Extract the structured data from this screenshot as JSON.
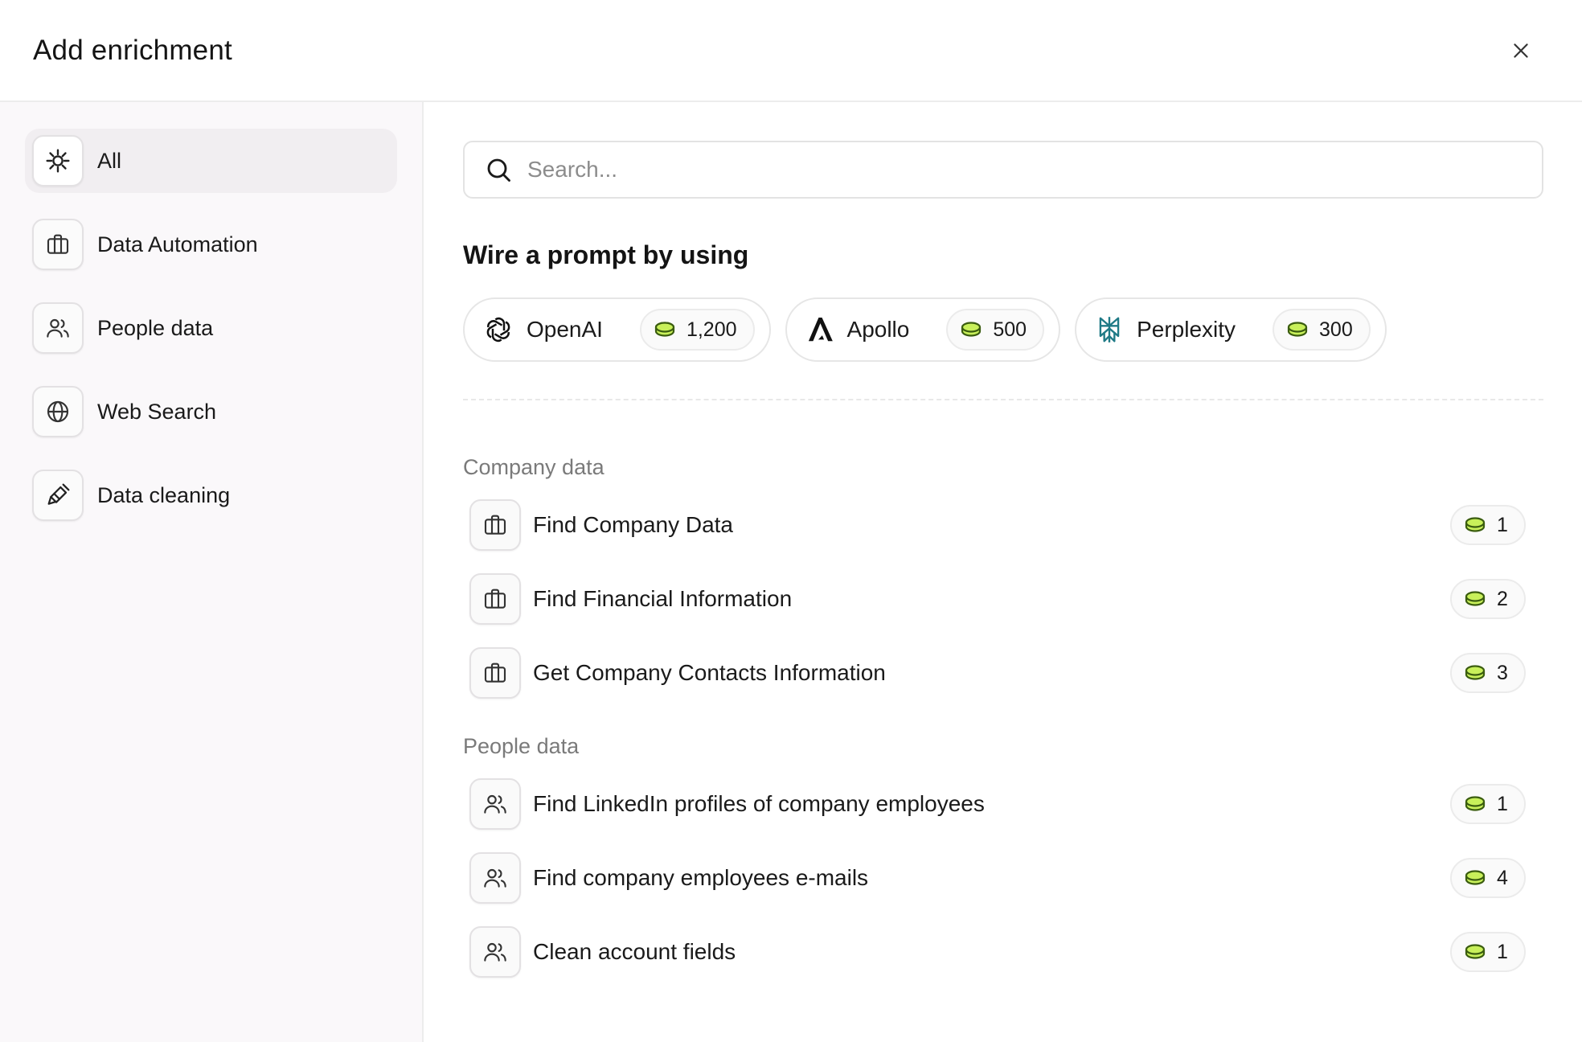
{
  "header": {
    "title": "Add enrichment"
  },
  "sidebar": {
    "items": [
      {
        "label": "All",
        "icon": "sparkle-icon",
        "active": true
      },
      {
        "label": "Data Automation",
        "icon": "briefcase-icon"
      },
      {
        "label": "People data",
        "icon": "users-icon"
      },
      {
        "label": "Web Search",
        "icon": "globe-icon"
      },
      {
        "label": "Data cleaning",
        "icon": "brush-icon"
      }
    ]
  },
  "search": {
    "placeholder": "Search..."
  },
  "prompt": {
    "heading": "Wire a prompt by using",
    "providers": [
      {
        "name": "OpenAI",
        "credits": "1,200",
        "icon": "openai-logo-icon"
      },
      {
        "name": "Apollo",
        "credits": "500",
        "icon": "apollo-logo-icon"
      },
      {
        "name": "Perplexity",
        "credits": "300",
        "icon": "perplexity-logo-icon"
      }
    ]
  },
  "groups": [
    {
      "label": "Company data",
      "items": [
        {
          "label": "Find Company Data",
          "credits": "1",
          "icon": "briefcase-icon"
        },
        {
          "label": "Find Financial Information",
          "credits": "2",
          "icon": "briefcase-icon"
        },
        {
          "label": "Get Company Contacts Information",
          "credits": "3",
          "icon": "briefcase-icon"
        }
      ]
    },
    {
      "label": "People data",
      "items": [
        {
          "label": "Find LinkedIn profiles of company employees",
          "credits": "1",
          "icon": "users-icon"
        },
        {
          "label": "Find company employees e-mails",
          "credits": "4",
          "icon": "users-icon"
        },
        {
          "label": "Clean account fields",
          "credits": "1",
          "icon": "users-icon"
        }
      ]
    }
  ],
  "colors": {
    "coin_fill": "#c8f05a",
    "coin_stroke": "#3b5d10",
    "perplexity": "#1f7a86"
  }
}
